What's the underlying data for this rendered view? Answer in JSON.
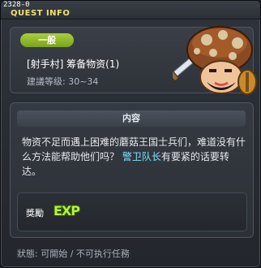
{
  "quest_id": "2328-0",
  "window_title": "QUEST INFO",
  "category_badge": "一般",
  "quest_name": "[射手村] 筹备物资(1)",
  "level_line": "建議等级: 30~34",
  "section_title": "内容",
  "description": {
    "part1": "物资不足而遇上困难的蘑菇王国士兵们，难道没有什么方法能帮助他们吗？ ",
    "highlight": "警卫队长",
    "part2": "有要紧的话要转达。"
  },
  "reward": {
    "label": "獎勵",
    "icon_text": "EXP",
    "icon_name": "exp-icon"
  },
  "status_line": "狀態: 可開始 / 不可执行任務",
  "colors": {
    "title_yellow": "#f2e36c",
    "badge_green": "#8fbf2a",
    "highlight_cyan": "#7fe0ff"
  },
  "npc_icon": "mushroom-warrior-portrait"
}
